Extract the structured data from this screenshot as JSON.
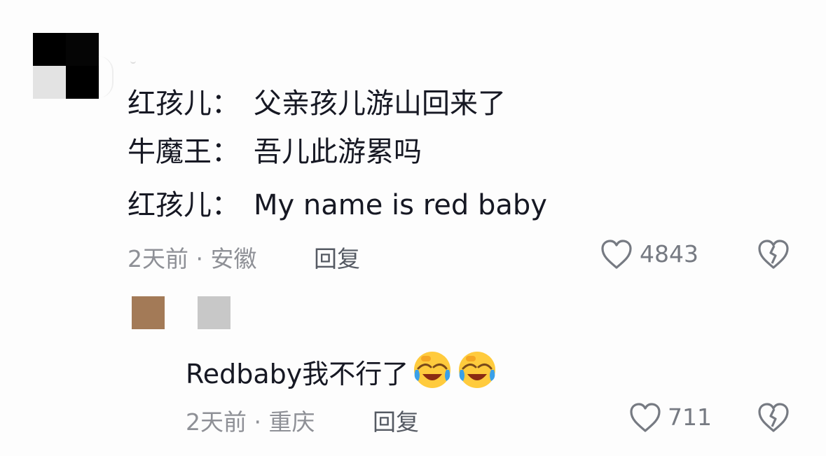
{
  "comment": {
    "lines": [
      {
        "speaker": "红孩儿：",
        "text": "父亲孩儿游山回来了"
      },
      {
        "speaker": "牛魔王：",
        "text": "吾儿此游累吗"
      },
      {
        "speaker": "红孩儿：",
        "text": "My name is red baby"
      }
    ],
    "meta": "2天前 · 安徽",
    "reply_label": "回复",
    "like_count": "4843",
    "like_icon": "heart-outline-icon",
    "dislike_icon": "broken-heart-icon"
  },
  "sub_reply": {
    "text": "Redbaby我不行了",
    "emojis": [
      "laughing-crying-emoji",
      "laughing-crying-emoji"
    ],
    "meta": "2天前 · 重庆",
    "reply_label": "回复",
    "like_count": "711"
  },
  "colors": {
    "text": "#161823",
    "meta": "#8e9096",
    "reply": "#555a63",
    "icon": "#767a82"
  }
}
